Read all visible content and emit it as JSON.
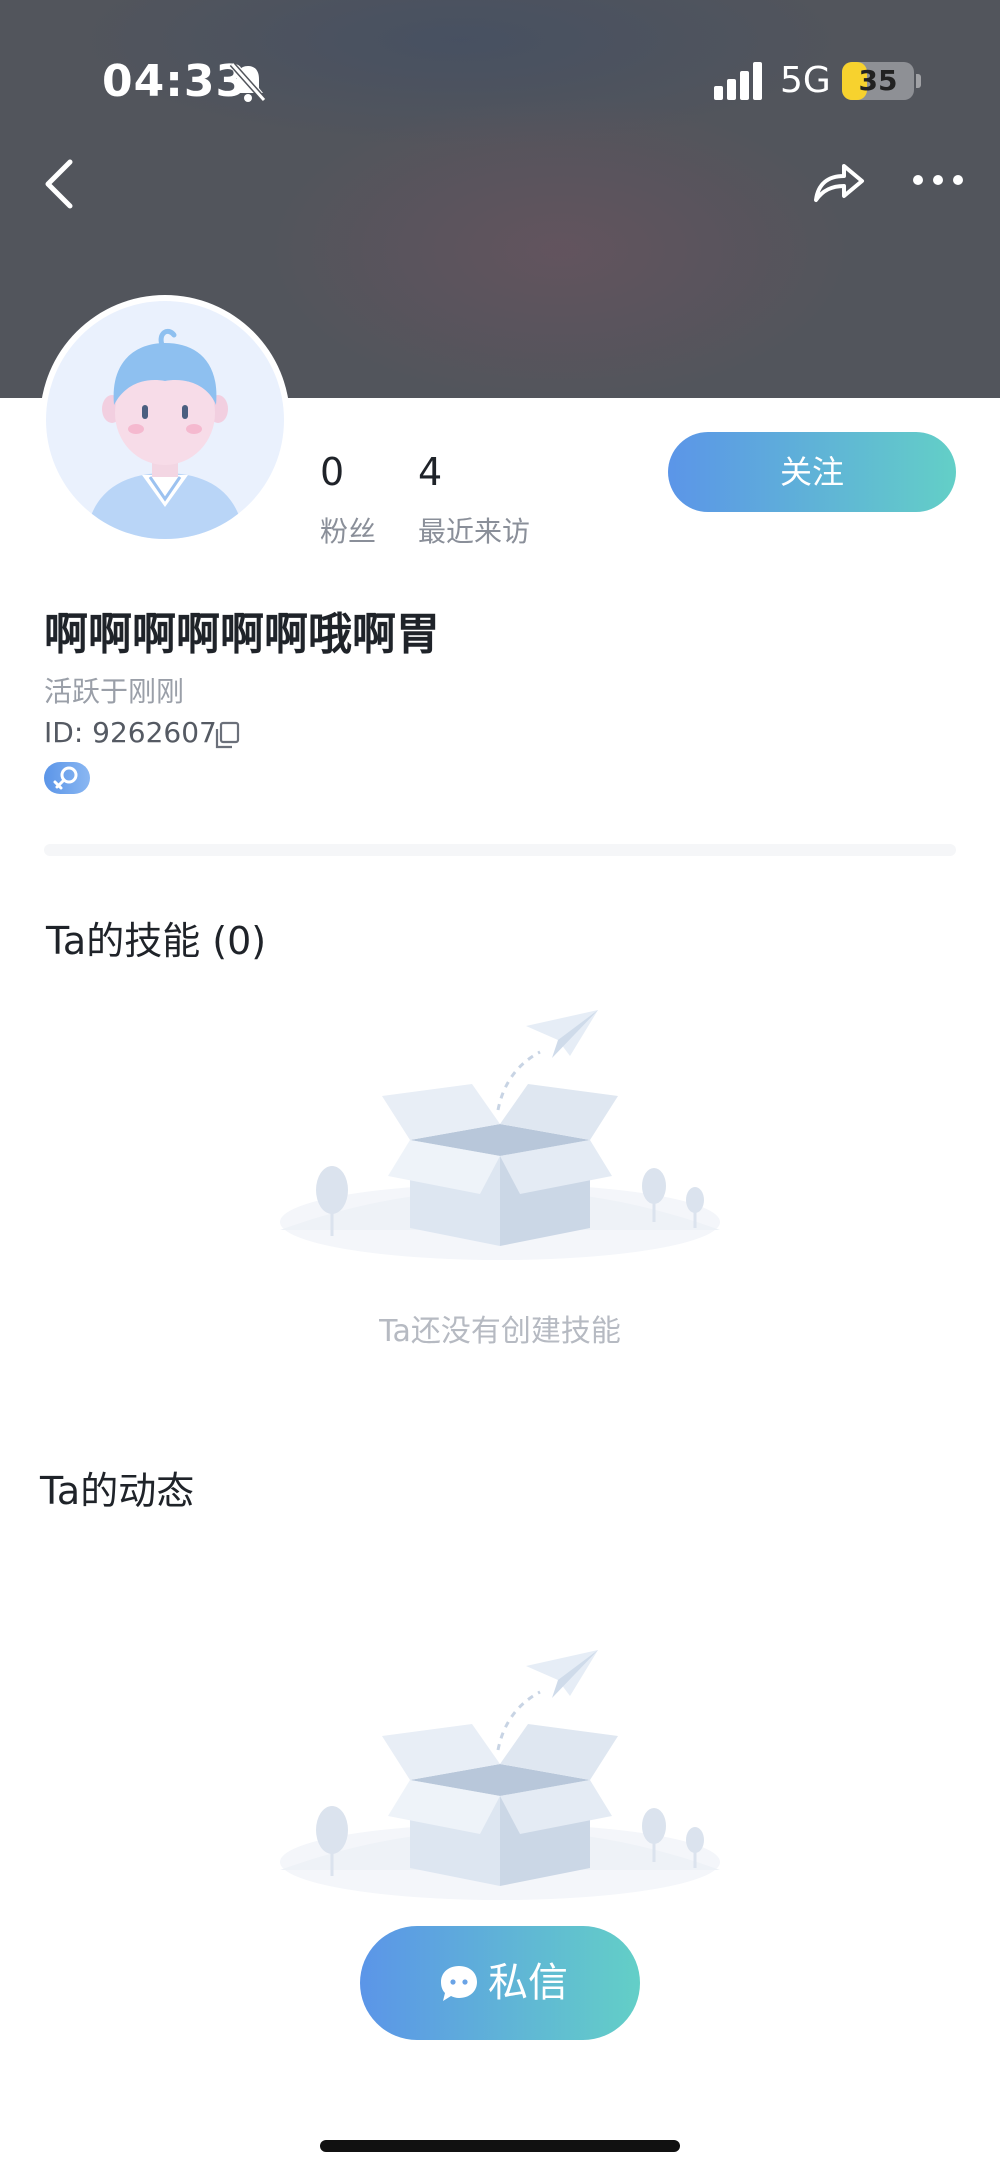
{
  "status_bar": {
    "time": "04:33",
    "network": "5G",
    "battery": "35",
    "battery_level": 0.35
  },
  "nav": {
    "back_icon": "chevron-left-icon",
    "share_icon": "share-arrow-icon",
    "more_icon": "more-dots-icon"
  },
  "profile": {
    "stats": [
      {
        "value": "0",
        "label": "粉丝"
      },
      {
        "value": "4",
        "label": "最近来访"
      }
    ],
    "follow_label": "关注",
    "nickname": "啊啊啊啊啊啊哦啊胃",
    "active_status": "活跃于刚刚",
    "id_text": "ID: 9262607"
  },
  "skills": {
    "title": "Ta的技能 (0)",
    "empty_text": "Ta还没有创建技能"
  },
  "moments": {
    "title": "Ta的动态"
  },
  "message_button": {
    "label": "私信"
  },
  "colors": {
    "accent_start": "#5b95e8",
    "accent_end": "#63cfc7",
    "header_bg": "#52555c"
  }
}
